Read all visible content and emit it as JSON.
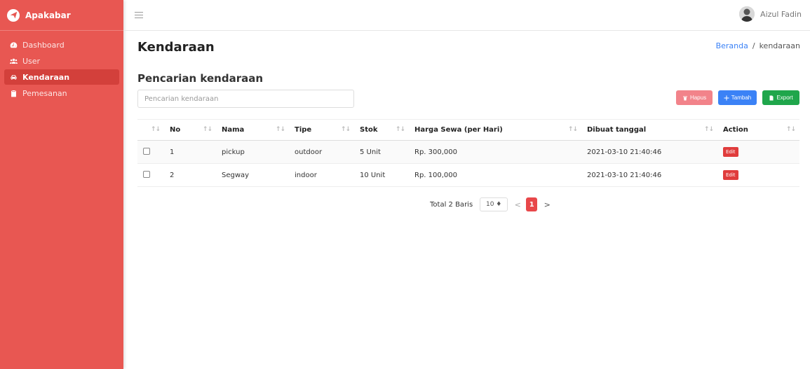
{
  "brand": {
    "name": "Apakabar"
  },
  "sidebar": {
    "items": [
      {
        "label": "Dashboard",
        "icon": "dashboard-icon",
        "active": false
      },
      {
        "label": "User",
        "icon": "users-icon",
        "active": false
      },
      {
        "label": "Kendaraan",
        "icon": "car-icon",
        "active": true
      },
      {
        "label": "Pemesanan",
        "icon": "clipboard-icon",
        "active": false
      }
    ]
  },
  "header": {
    "user_name": "Aizul Fadin"
  },
  "page": {
    "title": "Kendaraan",
    "breadcrumb": {
      "home": "Beranda",
      "separator": "/",
      "current": "kendaraan"
    },
    "section_title": "Pencarian kendaraan",
    "search_placeholder": "Pencarian kendaraan"
  },
  "actions": {
    "hapus": "Hapus",
    "tambah": "Tambah",
    "export": "Export"
  },
  "table": {
    "columns": [
      "No",
      "Nama",
      "Tipe",
      "Stok",
      "Harga Sewa (per Hari)",
      "Dibuat tanggal",
      "Action"
    ],
    "rows": [
      {
        "no": "1",
        "nama": "pickup",
        "tipe": "outdoor",
        "stok": "5 Unit",
        "harga": "Rp. 300,000",
        "tanggal": "2021-03-10 21:40:46",
        "action": "Edit"
      },
      {
        "no": "2",
        "nama": "Segway",
        "tipe": "indoor",
        "stok": "10 Unit",
        "harga": "Rp. 100,000",
        "tanggal": "2021-03-10 21:40:46",
        "action": "Edit"
      }
    ]
  },
  "pagination": {
    "total_label": "Total 2 Baris",
    "page_size": "10 ♦",
    "current_page": "1",
    "prev": "<",
    "next": ">"
  },
  "colors": {
    "sidebar": "#e85752",
    "primary": "#3b82f6",
    "success": "#1fa64b",
    "danger": "#e03c3c"
  }
}
